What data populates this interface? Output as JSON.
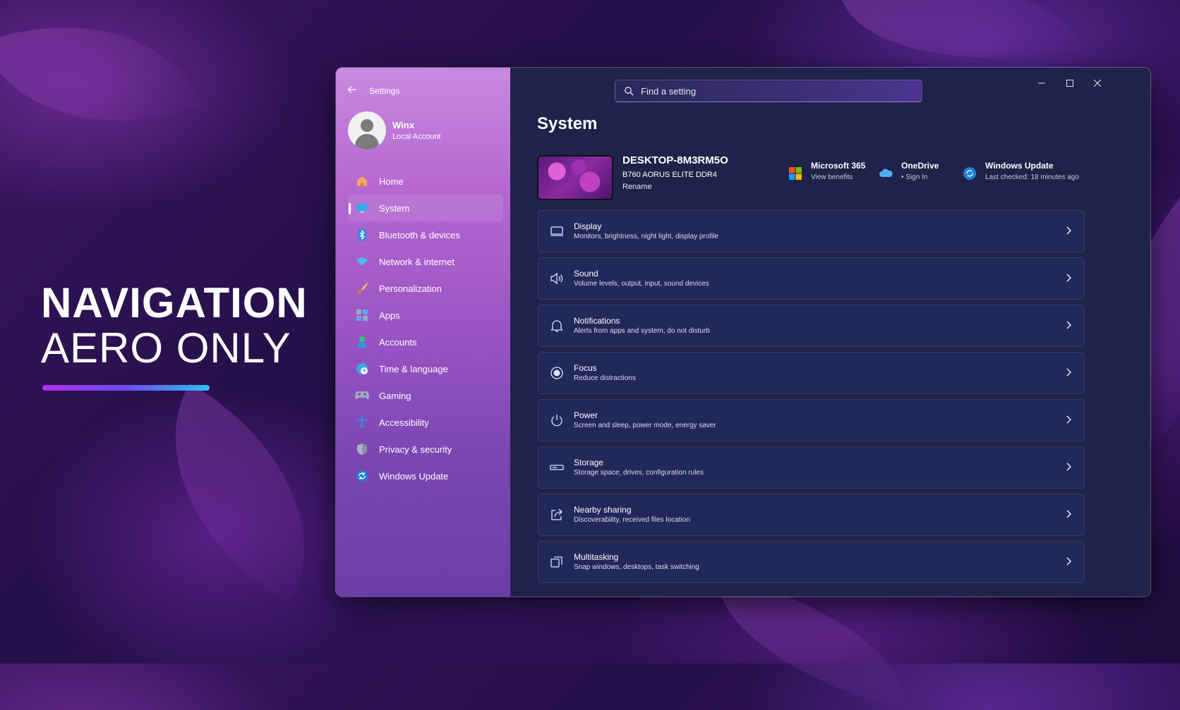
{
  "hero": {
    "line1": "NAVIGATION",
    "line2": "AERO ONLY"
  },
  "window": {
    "app_title": "Settings",
    "profile": {
      "name": "Winx",
      "account_type": "Local Account"
    },
    "nav": [
      {
        "label": "Home",
        "icon": "home-icon"
      },
      {
        "label": "System",
        "icon": "system-icon",
        "active": true
      },
      {
        "label": "Bluetooth & devices",
        "icon": "bluetooth-icon"
      },
      {
        "label": "Network & internet",
        "icon": "wifi-icon"
      },
      {
        "label": "Personalization",
        "icon": "brush-icon"
      },
      {
        "label": "Apps",
        "icon": "apps-icon"
      },
      {
        "label": "Accounts",
        "icon": "person-icon"
      },
      {
        "label": "Time & language",
        "icon": "globe-icon"
      },
      {
        "label": "Gaming",
        "icon": "controller-icon"
      },
      {
        "label": "Accessibility",
        "icon": "accessibility-icon"
      },
      {
        "label": "Privacy & security",
        "icon": "shield-icon"
      },
      {
        "label": "Windows Update",
        "icon": "update-icon"
      }
    ],
    "search": {
      "placeholder": "Find a setting"
    },
    "page_title": "System",
    "device": {
      "name": "DESKTOP-8M3RM5O",
      "model": "B760 AORUS ELITE DDR4",
      "rename": "Rename"
    },
    "quick": [
      {
        "title": "Microsoft 365",
        "subtitle": "View benefits",
        "icon": "microsoft-logo-icon"
      },
      {
        "title": "OneDrive",
        "subtitle": "• Sign In",
        "icon": "cloud-icon"
      },
      {
        "title": "Windows Update",
        "subtitle": "Last checked: 18 minutes ago",
        "icon": "update-icon"
      }
    ],
    "cards": [
      {
        "title": "Display",
        "subtitle": "Monitors, brightness, night light, display profile",
        "icon": "display-icon"
      },
      {
        "title": "Sound",
        "subtitle": "Volume levels, output, input, sound devices",
        "icon": "speaker-icon"
      },
      {
        "title": "Notifications",
        "subtitle": "Alerts from apps and system, do not disturb",
        "icon": "bell-icon"
      },
      {
        "title": "Focus",
        "subtitle": "Reduce distractions",
        "icon": "focus-icon"
      },
      {
        "title": "Power",
        "subtitle": "Screen and sleep, power mode, energy saver",
        "icon": "power-icon"
      },
      {
        "title": "Storage",
        "subtitle": "Storage space, drives, configuration rules",
        "icon": "storage-icon"
      },
      {
        "title": "Nearby sharing",
        "subtitle": "Discoverability, received files location",
        "icon": "share-icon"
      },
      {
        "title": "Multitasking",
        "subtitle": "Snap windows, desktops, task switching",
        "icon": "multitasking-icon"
      }
    ]
  },
  "colors": {
    "accent": "#4cc2ff",
    "sidebar_top": "#c88ae0",
    "main_bg": "#1f2349"
  }
}
